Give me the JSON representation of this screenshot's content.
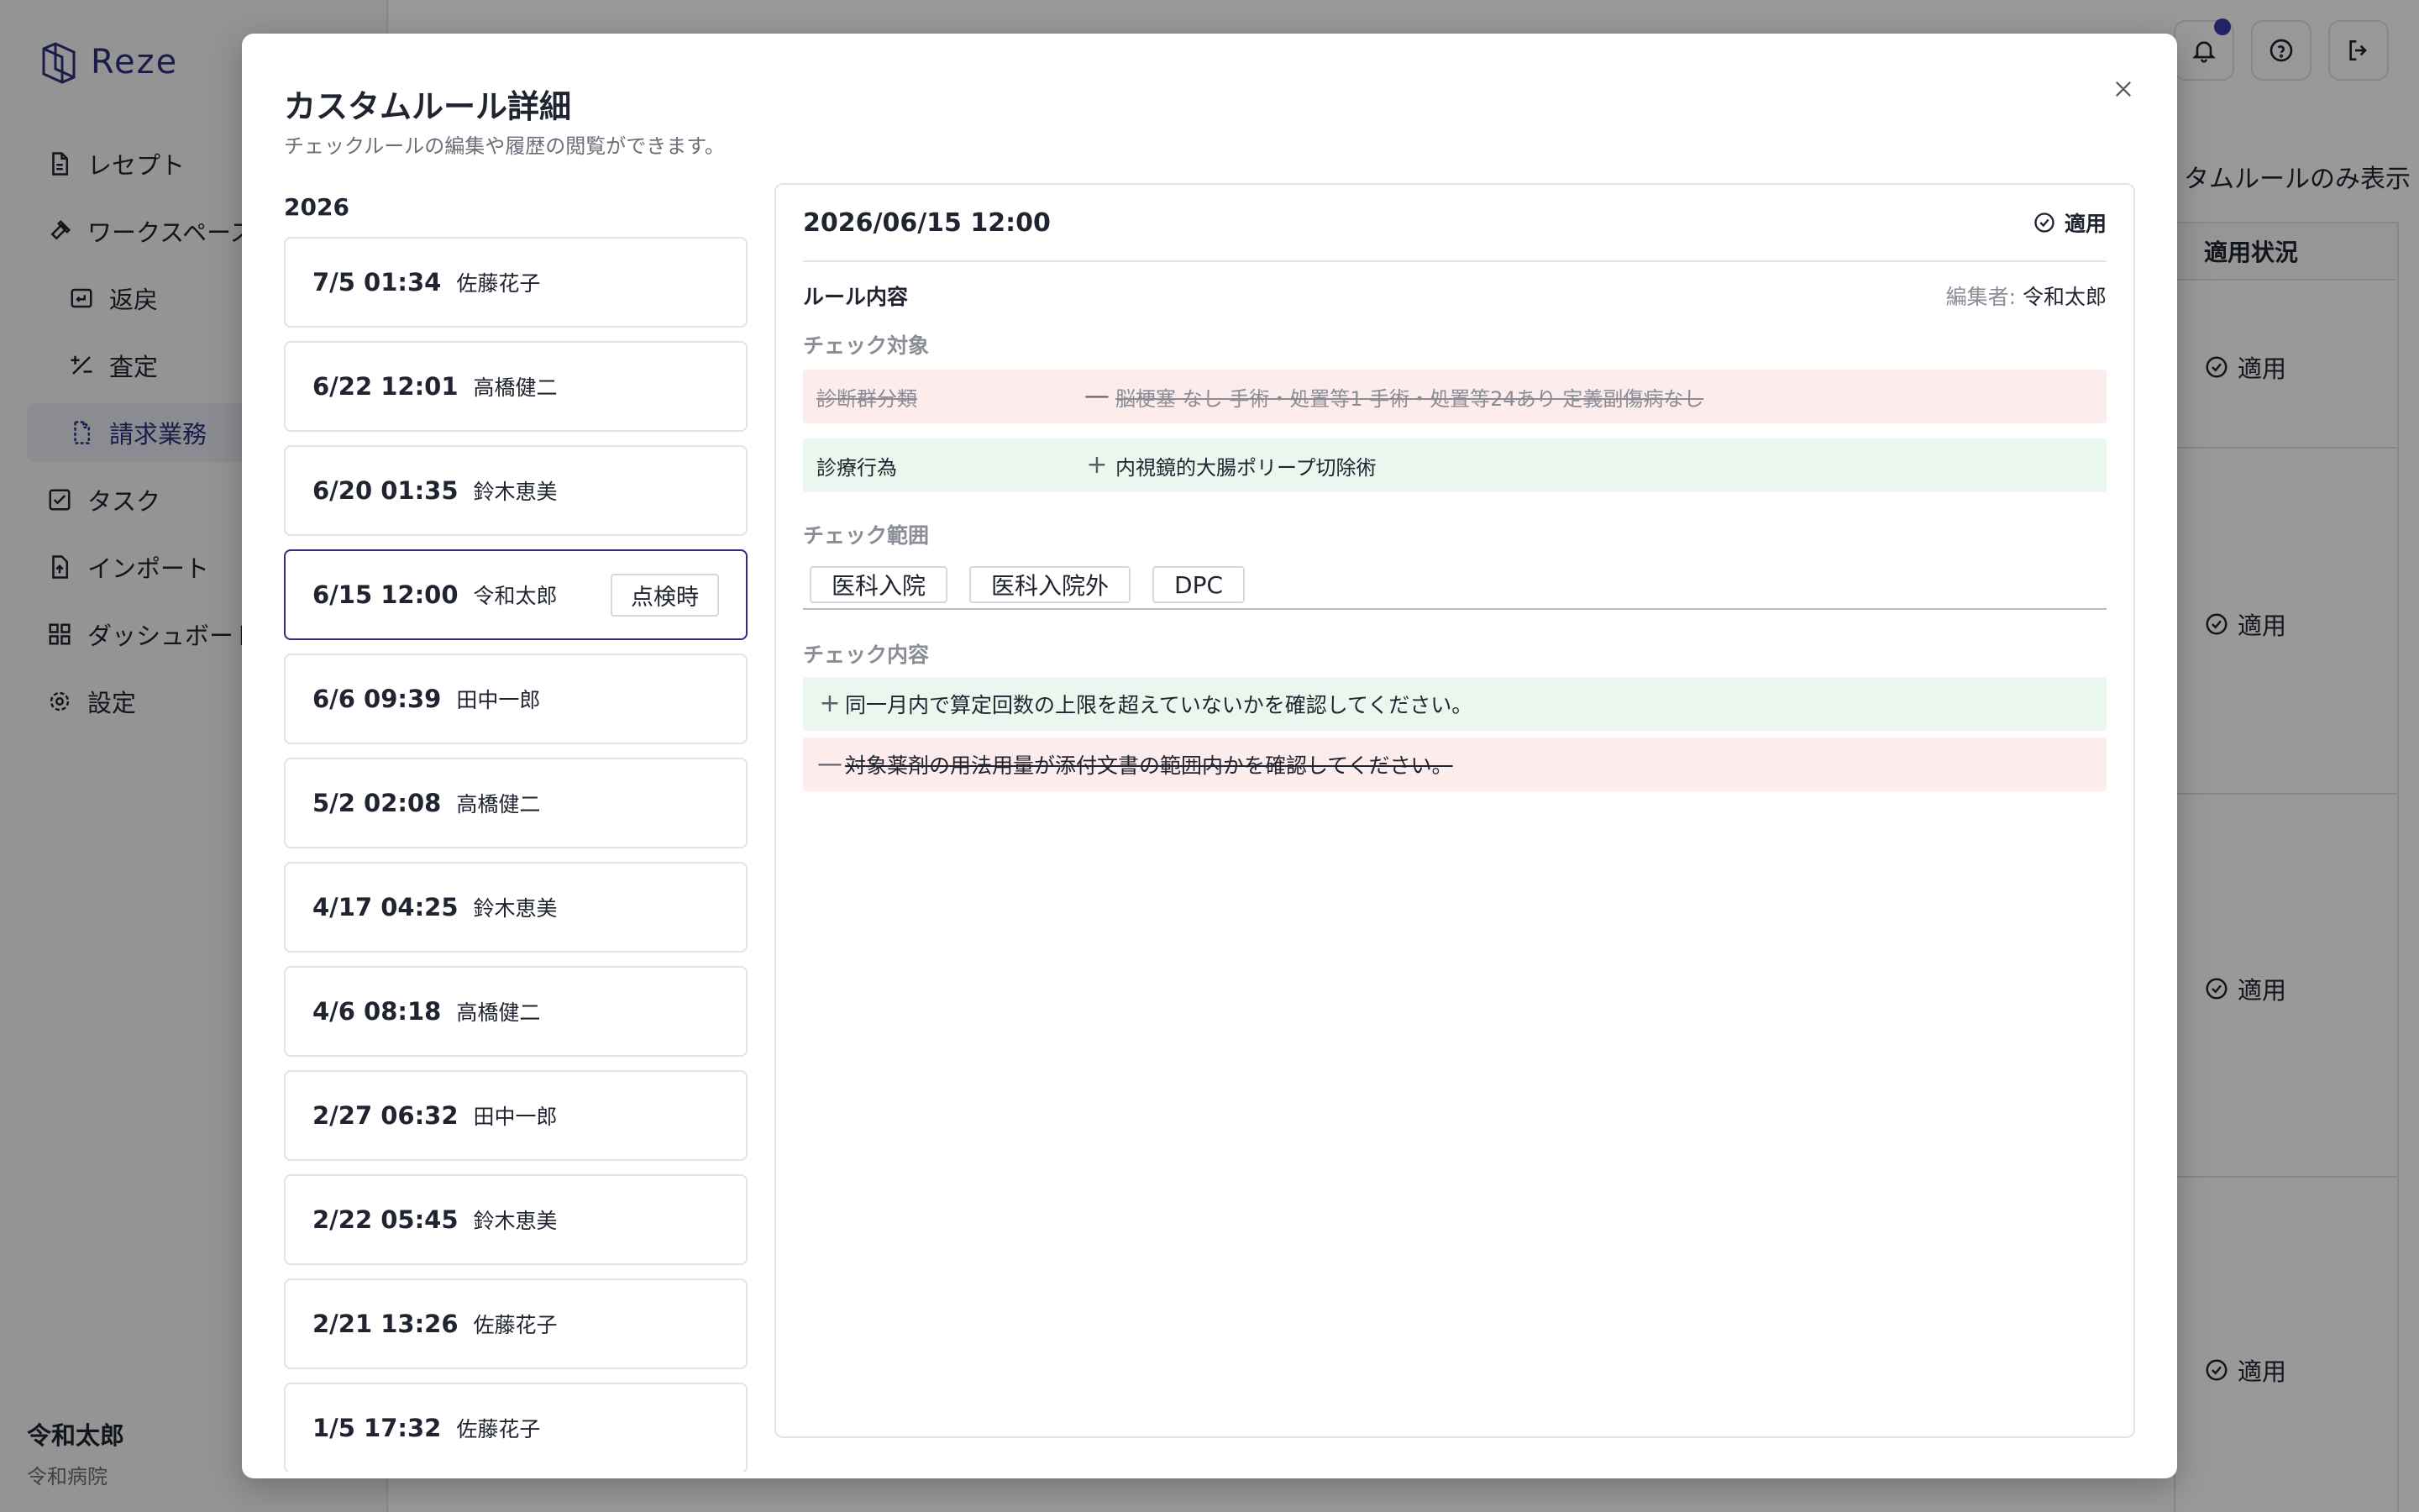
{
  "app": {
    "logo_text": "Reze",
    "nav": [
      {
        "label": "レセプト",
        "icon": "document-icon"
      },
      {
        "label": "ワークスペース",
        "icon": "hammer-icon"
      },
      {
        "label": "返戻",
        "icon": "return-icon"
      },
      {
        "label": "査定",
        "icon": "plus-minus-icon"
      },
      {
        "label": "請求業務",
        "icon": "document-icon"
      },
      {
        "label": "タスク",
        "icon": "checkbox-icon"
      },
      {
        "label": "インポート",
        "icon": "import-icon"
      },
      {
        "label": "ダッシュボード",
        "icon": "grid-icon"
      },
      {
        "label": "設定",
        "icon": "gear-icon"
      }
    ],
    "user": {
      "name": "令和太郎",
      "org": "令和病院"
    },
    "filter_label": "タムルールのみ表示",
    "table": {
      "header": "適用状況",
      "rows": [
        "適用",
        "適用",
        "適用",
        "適用"
      ]
    }
  },
  "modal": {
    "title": "カスタムルール詳細",
    "description": "チェックルールの編集や履歴の閲覧ができます。",
    "history": {
      "year": "2026",
      "items": [
        {
          "time": "7/5 01:34",
          "editor": "佐藤花子"
        },
        {
          "time": "6/22 12:01",
          "editor": "高橋健二"
        },
        {
          "time": "6/20 01:35",
          "editor": "鈴木恵美"
        },
        {
          "time": "6/15 12:00",
          "editor": "令和太郎",
          "badge": "点検時"
        },
        {
          "time": "6/6 09:39",
          "editor": "田中一郎"
        },
        {
          "time": "5/2 02:08",
          "editor": "高橋健二"
        },
        {
          "time": "4/17 04:25",
          "editor": "鈴木恵美"
        },
        {
          "time": "4/6 08:18",
          "editor": "高橋健二"
        },
        {
          "time": "2/27 06:32",
          "editor": "田中一郎"
        },
        {
          "time": "2/22 05:45",
          "editor": "鈴木恵美"
        },
        {
          "time": "2/21 13:26",
          "editor": "佐藤花子"
        },
        {
          "time": "1/5 17:32",
          "editor": "佐藤花子"
        }
      ]
    },
    "detail": {
      "date": "2026/06/15 12:00",
      "status": "適用",
      "rule_content_label": "ルール内容",
      "editor_key": "編集者:",
      "editor_value": "令和太郎",
      "check_target_label": "チェック対象",
      "targets": [
        {
          "key": "診断群分類",
          "sign": "—",
          "value": "脳梗塞 なし 手術・処置等1 手術・処置等24あり 定義副傷病なし"
        },
        {
          "key": "診療行為",
          "sign": "+",
          "value": "内視鏡的大腸ポリープ切除術"
        }
      ],
      "check_scope_label": "チェック範囲",
      "scopes": [
        "医科入院",
        "医科入院外",
        "DPC"
      ],
      "check_content_label": "チェック内容",
      "contents": [
        {
          "sign": "+",
          "text": "同一月内で算定回数の上限を超えていないかを確認してください。"
        },
        {
          "sign": "—",
          "text": "対象薬剤の用法用量が添付文書の範囲内かを確認してください。"
        }
      ]
    }
  }
}
